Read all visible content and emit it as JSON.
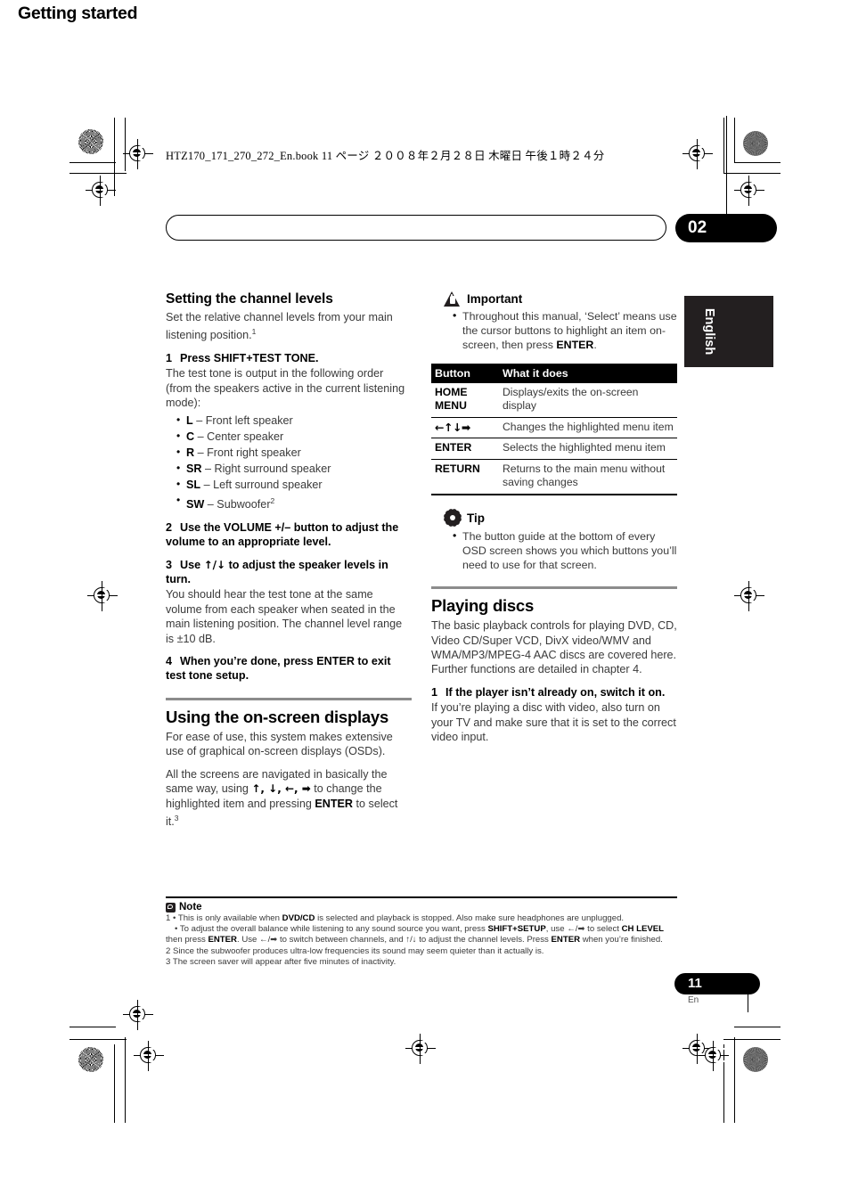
{
  "print_slug": "HTZ170_171_270_272_En.book   11 ページ   ２００８年２月２８日   木曜日   午後１時２４分",
  "banner": {
    "title": "Getting started",
    "chapter_number": "02"
  },
  "side_tab": {
    "language": "English"
  },
  "left_column": {
    "section1_heading": "Setting the channel levels",
    "section1_intro": "Set the relative channel levels from your main listening position.",
    "section1_intro_footnote": "1",
    "step1_num": "1",
    "step1_label": "Press SHIFT+TEST TONE.",
    "step1_body": "The test tone is output in the following order (from the speakers active in the current listening mode):",
    "speakers": [
      {
        "key": "L",
        "desc": "– Front left speaker",
        "fn": ""
      },
      {
        "key": "C",
        "desc": "– Center speaker",
        "fn": ""
      },
      {
        "key": "R",
        "desc": "– Front right speaker",
        "fn": ""
      },
      {
        "key": "SR",
        "desc": "– Right surround speaker",
        "fn": ""
      },
      {
        "key": "SL",
        "desc": "– Left surround speaker",
        "fn": ""
      },
      {
        "key": "SW",
        "desc": "– Subwoofer",
        "fn": "2"
      }
    ],
    "step2_num": "2",
    "step2_label": "Use the VOLUME +/– button to adjust the volume to an appropriate level.",
    "step3_num": "3",
    "step3_label_pre": "Use ",
    "step3_arrows": "↑/↓",
    "step3_label_post": " to adjust the speaker levels in turn.",
    "step3_body": "You should hear the test tone at the same volume from each speaker when seated in the main listening position. The channel level range is ±10 dB.",
    "step4_num": "4",
    "step4_label": "When you’re done, press ENTER to exit test tone setup.",
    "section2_heading": "Using the on-screen displays",
    "section2_p1": "For ease of use, this system makes extensive use of graphical on-screen displays (OSDs).",
    "section2_p2_a": "All the screens are navigated in basically the same way, using ",
    "section2_p2_arrows": "↑, ↓, ←, ➡",
    "section2_p2_b": " to change the highlighted item and pressing ",
    "section2_p2_enter": "ENTER",
    "section2_p2_c": " to select it.",
    "section2_p2_fn": "3"
  },
  "right_column": {
    "important_label": "Important",
    "important_bullet_a": "Throughout this manual, ‘Select’ means use the cursor buttons to highlight an item on-screen, then press ",
    "important_bullet_enter": "ENTER",
    "important_bullet_b": ".",
    "table": {
      "headers": [
        "Button",
        "What it does"
      ],
      "rows": [
        {
          "button": "HOME\nMENU",
          "does": "Displays/exits the on-screen display"
        },
        {
          "button": "←↑↓➡",
          "does": "Changes the highlighted menu item"
        },
        {
          "button": "ENTER",
          "does": "Selects the highlighted menu item"
        },
        {
          "button": "RETURN",
          "does": "Returns to the main menu without saving changes"
        }
      ]
    },
    "tip_label": "Tip",
    "tip_bullet": "The button guide at the bottom of every OSD screen shows you which buttons you’ll need to use for that screen.",
    "section_heading": "Playing discs",
    "section_p1": "The basic playback controls for playing DVD, CD, Video CD/Super VCD, DivX video/WMV and WMA/MP3/MPEG-4 AAC discs are covered here. Further functions are detailed in chapter 4.",
    "step1_num": "1",
    "step1_label": "If the player isn’t already on, switch it on.",
    "step1_body": "If you’re playing a disc with video, also turn on your TV and make sure that it is set to the correct video input."
  },
  "footnotes": {
    "label": "Note",
    "n1_a": "1 • This is only available when ",
    "n1_dvdcd": "DVD/CD",
    "n1_b": " is selected and playback is stopped. Also make sure headphones are unplugged.",
    "n2_a": "• To adjust the overall balance while listening to any sound source you want, press ",
    "n2_shift": "SHIFT+SETUP",
    "n2_b": ", use ←/➡ to select ",
    "n2_chlevel": "CH LEVEL",
    "n2_c": " then press ",
    "n2_enter1": "ENTER",
    "n2_d": ". Use ←/➡ to switch between channels, and ↑/↓ to adjust the channel levels. Press ",
    "n2_enter2": "ENTER",
    "n2_e": " when you’re finished.",
    "n3": "2 Since the subwoofer produces ultra-low frequencies its sound may seem quieter than it actually is.",
    "n4": "3 The screen saver will appear after five minutes of inactivity."
  },
  "page_footer": {
    "number": "11",
    "language_code": "En"
  }
}
